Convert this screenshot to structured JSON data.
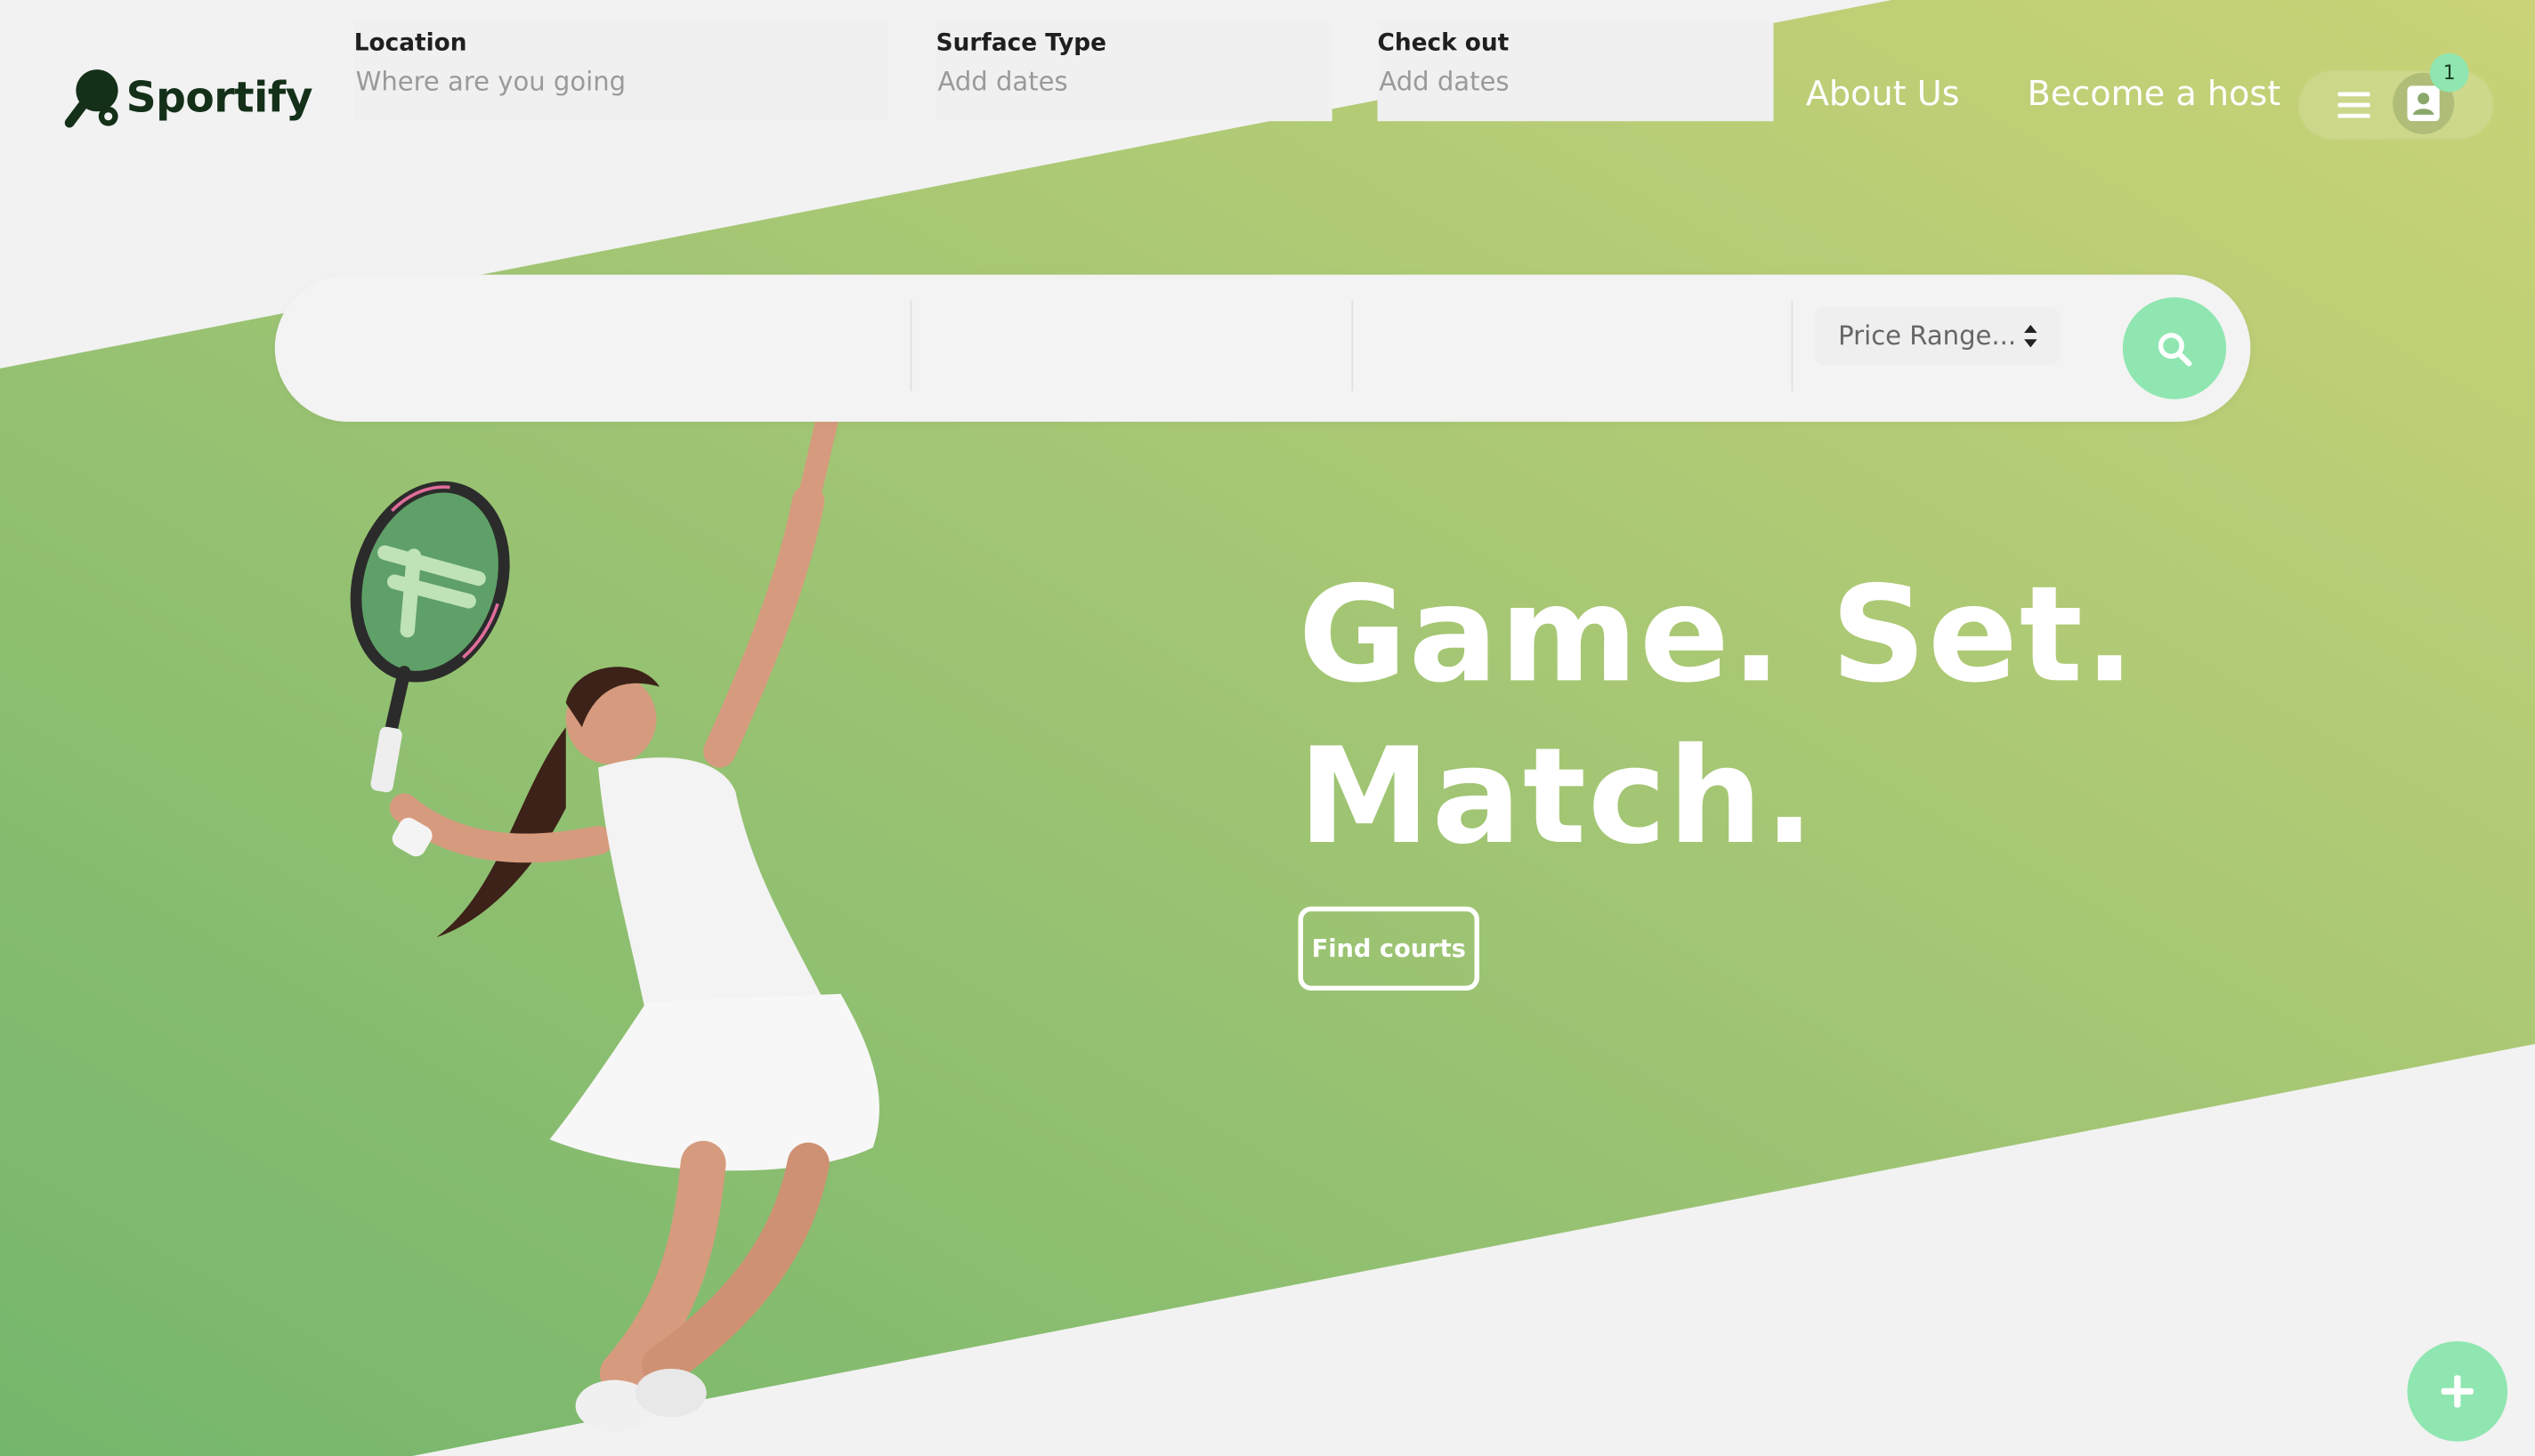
{
  "header": {
    "brand": "Sportify",
    "nav": [
      {
        "label": "About Us"
      },
      {
        "label": "Become a host"
      }
    ],
    "notification_count": "1"
  },
  "search": {
    "location": {
      "label": "Location",
      "placeholder": "Where are you going"
    },
    "surface": {
      "label": "Surface Type",
      "placeholder": "Add dates"
    },
    "checkout": {
      "label": "Check out",
      "placeholder": "Add dates"
    },
    "price": {
      "selected": "Price Range..."
    }
  },
  "hero": {
    "line1": "Game. Set.",
    "line2": "Match.",
    "cta_label": "Find courts"
  },
  "colors": {
    "accent": "#8fe6b0",
    "band_start": "#7cb86e",
    "band_end": "#c8d278",
    "background": "#f2f2f2",
    "brand_text": "#143019"
  },
  "icons": [
    "logo-icon",
    "menu-icon",
    "profile-icon",
    "sort-caret-icon",
    "search-icon",
    "plus-icon"
  ]
}
